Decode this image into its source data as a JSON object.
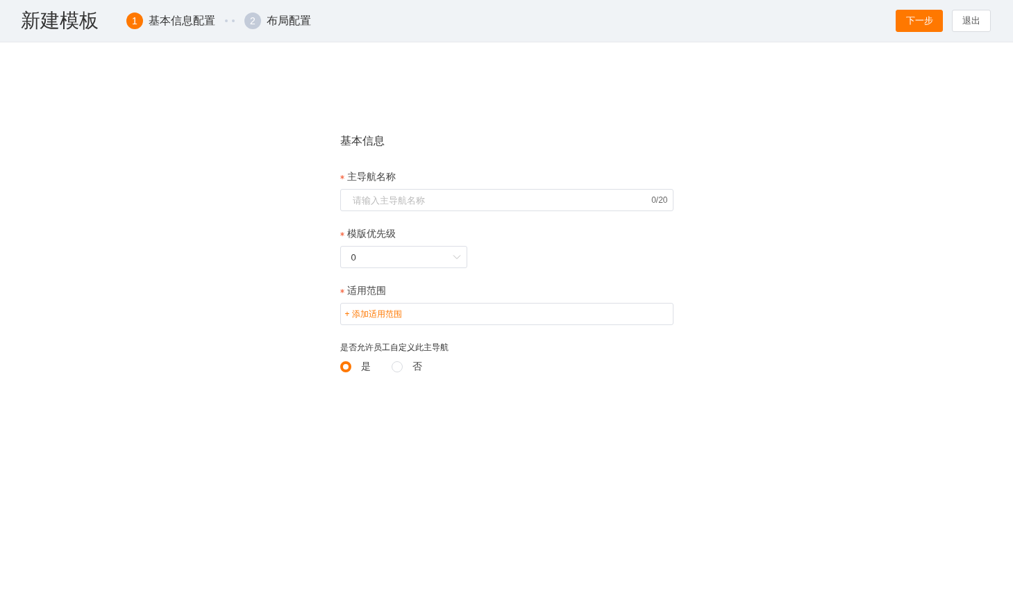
{
  "header": {
    "title": "新建模板",
    "steps": [
      {
        "number": "1",
        "label": "基本信息配置",
        "selected": true
      },
      {
        "number": "2",
        "label": "布局配置",
        "selected": false
      }
    ],
    "buttons": [
      {
        "label": "下一步",
        "kind": "primary"
      },
      {
        "label": "退出",
        "kind": "default"
      }
    ]
  },
  "form": {
    "section_title": "基本信息",
    "fields": [
      {
        "kind": "text",
        "label": "主导航名称",
        "required": true,
        "placeholder": "请输入主导航名称",
        "counter": "0/20"
      },
      {
        "kind": "select",
        "label": "模版优先级",
        "required": true,
        "value": "0"
      },
      {
        "kind": "add",
        "label": "适用范围",
        "required": true,
        "action": "+ 添加适用范围"
      },
      {
        "kind": "radio",
        "label": "是否允许员工自定义此主导航",
        "required": false,
        "options": [
          {
            "label": "是",
            "selected": true
          },
          {
            "label": "否",
            "selected": false
          }
        ]
      }
    ]
  }
}
